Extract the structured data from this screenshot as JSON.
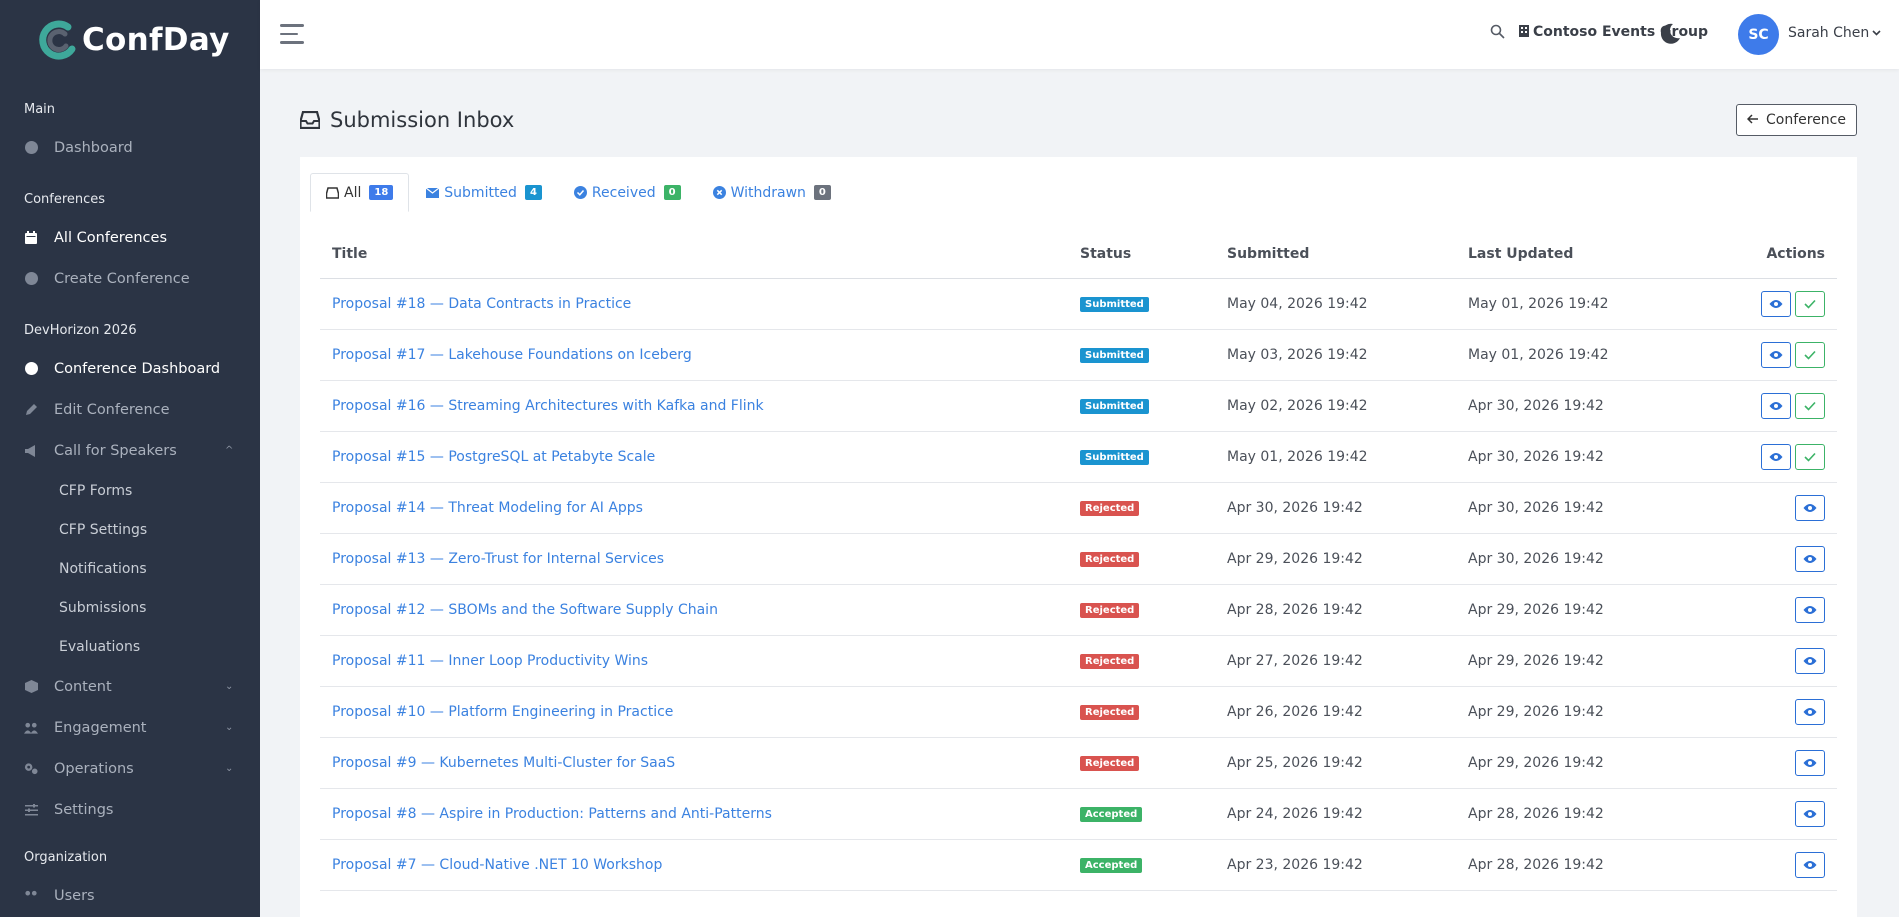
{
  "brand": {
    "name": "ConfDay"
  },
  "sidebar": {
    "sections": [
      {
        "label": "Main",
        "items": [
          {
            "label": "Dashboard"
          }
        ]
      },
      {
        "label": "Conferences",
        "items": [
          {
            "label": "All Conferences"
          },
          {
            "label": "Create Conference"
          }
        ]
      },
      {
        "label": "DevHorizon 2026",
        "items": [
          {
            "label": "Conference Dashboard"
          },
          {
            "label": "Edit Conference"
          },
          {
            "label": "Call for Speakers",
            "children": [
              "CFP Forms",
              "CFP Settings",
              "Notifications",
              "Submissions",
              "Evaluations"
            ]
          },
          {
            "label": "Content"
          },
          {
            "label": "Engagement"
          },
          {
            "label": "Operations"
          },
          {
            "label": "Settings"
          }
        ]
      },
      {
        "label": "Organization",
        "items": [
          {
            "label": "Users"
          }
        ]
      }
    ]
  },
  "topbar": {
    "org": "Contoso Events Group",
    "user": {
      "initials": "SC",
      "name": "Sarah Chen"
    }
  },
  "page": {
    "title": "Submission Inbox",
    "back_label": "Conference"
  },
  "tabs": [
    {
      "label": "All",
      "count": "18"
    },
    {
      "label": "Submitted",
      "count": "4"
    },
    {
      "label": "Received",
      "count": "0"
    },
    {
      "label": "Withdrawn",
      "count": "0"
    }
  ],
  "table": {
    "headers": {
      "title": "Title",
      "status": "Status",
      "submitted": "Submitted",
      "updated": "Last Updated",
      "actions": "Actions"
    },
    "rows": [
      {
        "title": "Proposal #18 — Data Contracts in Practice",
        "status": "Submitted",
        "submitted": "May 04, 2026 19:42",
        "updated": "May 01, 2026 19:42"
      },
      {
        "title": "Proposal #17 — Lakehouse Foundations on Iceberg",
        "status": "Submitted",
        "submitted": "May 03, 2026 19:42",
        "updated": "May 01, 2026 19:42"
      },
      {
        "title": "Proposal #16 — Streaming Architectures with Kafka and Flink",
        "status": "Submitted",
        "submitted": "May 02, 2026 19:42",
        "updated": "Apr 30, 2026 19:42"
      },
      {
        "title": "Proposal #15 — PostgreSQL at Petabyte Scale",
        "status": "Submitted",
        "submitted": "May 01, 2026 19:42",
        "updated": "Apr 30, 2026 19:42"
      },
      {
        "title": "Proposal #14 — Threat Modeling for AI Apps",
        "status": "Rejected",
        "submitted": "Apr 30, 2026 19:42",
        "updated": "Apr 30, 2026 19:42"
      },
      {
        "title": "Proposal #13 — Zero-Trust for Internal Services",
        "status": "Rejected",
        "submitted": "Apr 29, 2026 19:42",
        "updated": "Apr 30, 2026 19:42"
      },
      {
        "title": "Proposal #12 — SBOMs and the Software Supply Chain",
        "status": "Rejected",
        "submitted": "Apr 28, 2026 19:42",
        "updated": "Apr 29, 2026 19:42"
      },
      {
        "title": "Proposal #11 — Inner Loop Productivity Wins",
        "status": "Rejected",
        "submitted": "Apr 27, 2026 19:42",
        "updated": "Apr 29, 2026 19:42"
      },
      {
        "title": "Proposal #10 — Platform Engineering in Practice",
        "status": "Rejected",
        "submitted": "Apr 26, 2026 19:42",
        "updated": "Apr 29, 2026 19:42"
      },
      {
        "title": "Proposal #9 — Kubernetes Multi-Cluster for SaaS",
        "status": "Rejected",
        "submitted": "Apr 25, 2026 19:42",
        "updated": "Apr 29, 2026 19:42"
      },
      {
        "title": "Proposal #8 — Aspire in Production: Patterns and Anti-Patterns",
        "status": "Accepted",
        "submitted": "Apr 24, 2026 19:42",
        "updated": "Apr 28, 2026 19:42"
      },
      {
        "title": "Proposal #7 — Cloud-Native .NET 10 Workshop",
        "status": "Accepted",
        "submitted": "Apr 23, 2026 19:42",
        "updated": "Apr 28, 2026 19:42"
      }
    ]
  },
  "colors": {
    "sidebar": "#2b3445",
    "link": "#3b82e0",
    "submitted": "#1a94d0",
    "rejected": "#d9534f",
    "accepted": "#3cb367",
    "primary": "#3e7bea"
  }
}
